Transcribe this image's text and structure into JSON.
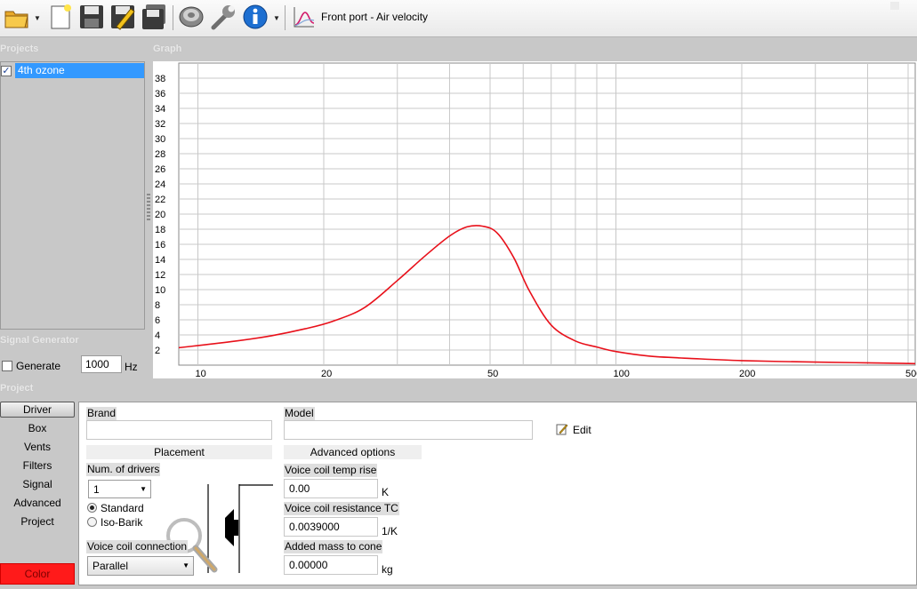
{
  "toolbar": {
    "title": "Front port - Air velocity",
    "icons": [
      "open-folder-icon",
      "new-document-icon",
      "save-icon",
      "save-as-icon",
      "save-all-icon",
      "driver-icon",
      "settings-wrench-icon",
      "info-icon",
      "graph-icon"
    ]
  },
  "projects": {
    "label": "Projects",
    "items": [
      {
        "label": "4th ozone",
        "checked": true
      }
    ]
  },
  "graph": {
    "label": "Graph"
  },
  "chart_data": {
    "type": "line",
    "x_scale": "log",
    "xlim": [
      9,
      520
    ],
    "ylim": [
      0,
      40
    ],
    "grid": true,
    "x_ticks": [
      {
        "value": 10,
        "label": "10"
      },
      {
        "value": 20,
        "label": "20"
      },
      {
        "value": 50,
        "label": "50"
      },
      {
        "value": 100,
        "label": "100"
      },
      {
        "value": 200,
        "label": "200"
      },
      {
        "value": 500,
        "label": "500"
      }
    ],
    "y_ticks": [
      2,
      4,
      6,
      8,
      10,
      12,
      14,
      16,
      18,
      20,
      22,
      24,
      26,
      28,
      30,
      32,
      34,
      36,
      38
    ],
    "series": [
      {
        "color": "#e8101a",
        "x": [
          9,
          12,
          15,
          18,
          21,
          25,
          30,
          35,
          40,
          44,
          48,
          52,
          57,
          62,
          70,
          80,
          90,
          100,
          120,
          150,
          200,
          300,
          400,
          520
        ],
        "y": [
          2.3,
          3.1,
          3.9,
          4.8,
          5.8,
          7.6,
          11.2,
          14.5,
          17.1,
          18.3,
          18.4,
          17.5,
          14.2,
          9.9,
          5.3,
          3.2,
          2.4,
          1.8,
          1.2,
          0.9,
          0.6,
          0.4,
          0.3,
          0.2
        ]
      }
    ]
  },
  "signal_generator": {
    "label": "Signal Generator",
    "generate_label": "Generate",
    "generate_checked": false,
    "frequency": "1000",
    "unit": "Hz"
  },
  "project_section": {
    "label": "Project",
    "nav": [
      "Driver",
      "Box",
      "Vents",
      "Filters",
      "Signal",
      "Advanced",
      "Project"
    ],
    "color_button": "Color",
    "color_button_bg": "#ff1a1a"
  },
  "driver": {
    "brand_label": "Brand",
    "brand_value": "",
    "model_label": "Model",
    "model_value": "",
    "edit_label": "Edit",
    "placement_header": "Placement",
    "num_drivers_label": "Num. of drivers",
    "num_drivers_value": "1",
    "standard_label": "Standard",
    "isobarik_label": "Iso-Barik",
    "placement_selected": "Standard",
    "voice_coil_connection_label": "Voice coil connection",
    "voice_coil_connection_value": "Parallel",
    "advanced_header": "Advanced options",
    "vc_temp_rise_label": "Voice coil temp rise",
    "vc_temp_rise_value": "0.00",
    "vc_temp_rise_unit": "K",
    "vc_resistance_tc_label": "Voice coil resistance TC",
    "vc_resistance_tc_value": "0.0039000",
    "vc_resistance_tc_unit": "1/K",
    "added_mass_label": "Added mass to cone",
    "added_mass_value": "0.00000",
    "added_mass_unit": "kg"
  }
}
